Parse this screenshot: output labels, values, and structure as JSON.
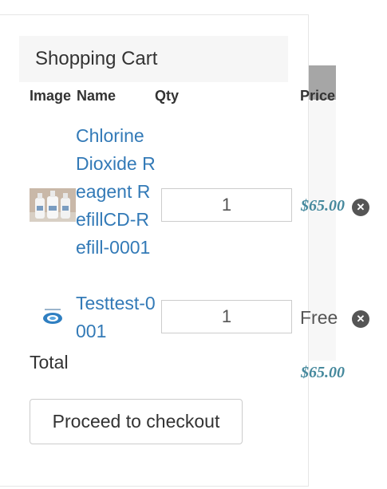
{
  "cart": {
    "title": "Shopping Cart",
    "columns": {
      "image": "Image",
      "name": "Name",
      "qty": "Qty",
      "price": "Price"
    },
    "items": [
      {
        "name": "Chlorine Dioxide Reagent RefillCD-Refill-0001",
        "qty": "1",
        "price": "$65.00"
      },
      {
        "name": "Testtest-0001",
        "qty": "1",
        "price": "Free"
      }
    ],
    "total_label": "Total",
    "total_value": "$65.00",
    "checkout_label": "Proceed to checkout"
  },
  "icons": {
    "remove": "remove-circle-icon"
  },
  "colors": {
    "link": "#337ab7",
    "price": "#46899d",
    "header_bg": "#f6f6f6"
  }
}
